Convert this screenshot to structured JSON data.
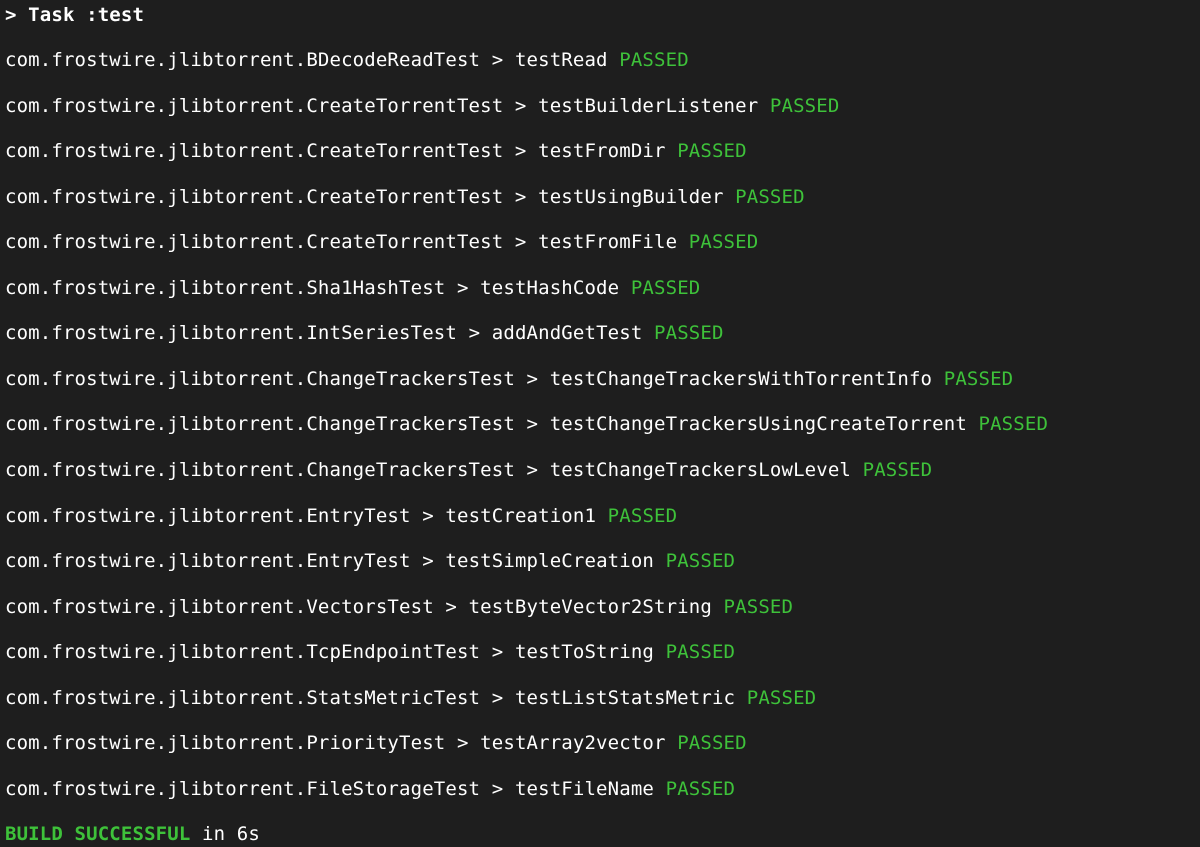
{
  "header": {
    "task_label": "> Task :test"
  },
  "results": [
    {
      "class": "com.frostwire.jlibtorrent.BDecodeReadTest",
      "test": "testRead",
      "status": "PASSED"
    },
    {
      "class": "com.frostwire.jlibtorrent.CreateTorrentTest",
      "test": "testBuilderListener",
      "status": "PASSED"
    },
    {
      "class": "com.frostwire.jlibtorrent.CreateTorrentTest",
      "test": "testFromDir",
      "status": "PASSED"
    },
    {
      "class": "com.frostwire.jlibtorrent.CreateTorrentTest",
      "test": "testUsingBuilder",
      "status": "PASSED"
    },
    {
      "class": "com.frostwire.jlibtorrent.CreateTorrentTest",
      "test": "testFromFile",
      "status": "PASSED"
    },
    {
      "class": "com.frostwire.jlibtorrent.Sha1HashTest",
      "test": "testHashCode",
      "status": "PASSED"
    },
    {
      "class": "com.frostwire.jlibtorrent.IntSeriesTest",
      "test": "addAndGetTest",
      "status": "PASSED"
    },
    {
      "class": "com.frostwire.jlibtorrent.ChangeTrackersTest",
      "test": "testChangeTrackersWithTorrentInfo",
      "status": "PASSED"
    },
    {
      "class": "com.frostwire.jlibtorrent.ChangeTrackersTest",
      "test": "testChangeTrackersUsingCreateTorrent",
      "status": "PASSED"
    },
    {
      "class": "com.frostwire.jlibtorrent.ChangeTrackersTest",
      "test": "testChangeTrackersLowLevel",
      "status": "PASSED"
    },
    {
      "class": "com.frostwire.jlibtorrent.EntryTest",
      "test": "testCreation1",
      "status": "PASSED"
    },
    {
      "class": "com.frostwire.jlibtorrent.EntryTest",
      "test": "testSimpleCreation",
      "status": "PASSED"
    },
    {
      "class": "com.frostwire.jlibtorrent.VectorsTest",
      "test": "testByteVector2String",
      "status": "PASSED"
    },
    {
      "class": "com.frostwire.jlibtorrent.TcpEndpointTest",
      "test": "testToString",
      "status": "PASSED"
    },
    {
      "class": "com.frostwire.jlibtorrent.StatsMetricTest",
      "test": "testListStatsMetric",
      "status": "PASSED"
    },
    {
      "class": "com.frostwire.jlibtorrent.PriorityTest",
      "test": "testArray2vector",
      "status": "PASSED"
    },
    {
      "class": "com.frostwire.jlibtorrent.FileStorageTest",
      "test": "testFileName",
      "status": "PASSED"
    }
  ],
  "separator": " > ",
  "footer": {
    "status": "BUILD SUCCESSFUL",
    "suffix": " in 6s"
  },
  "colors": {
    "background": "#1e1e1e",
    "text": "#ffffff",
    "pass": "#3ec23a"
  }
}
